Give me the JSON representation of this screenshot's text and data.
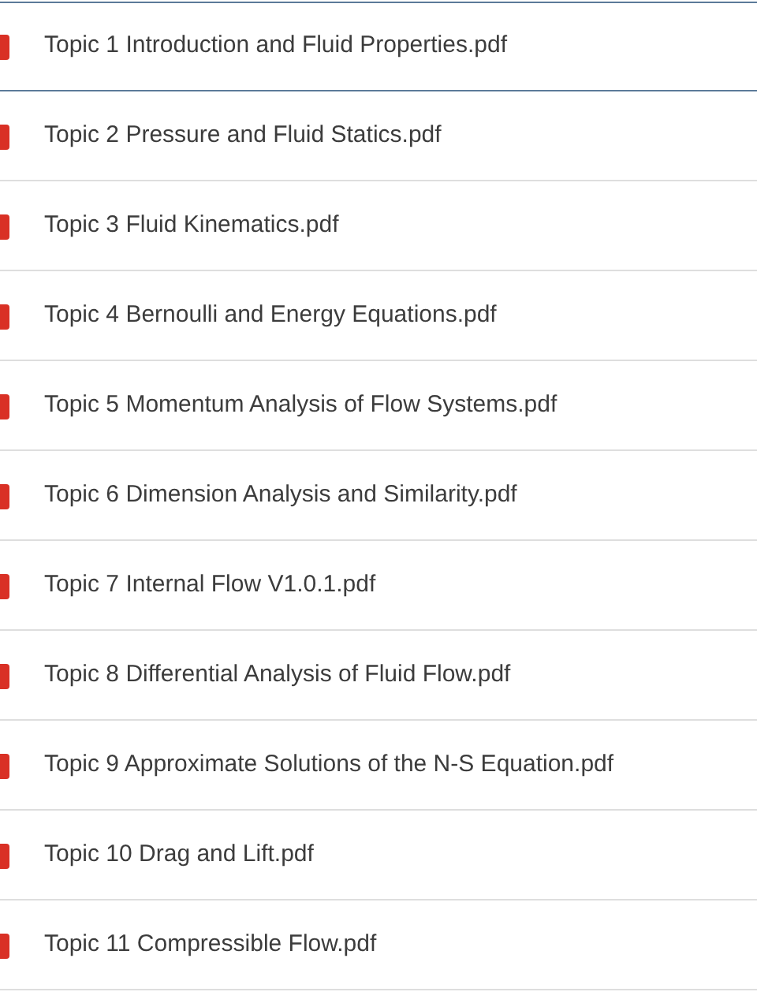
{
  "files": [
    {
      "name": "Topic 1 Introduction and Fluid Properties.pdf",
      "selected": true
    },
    {
      "name": "Topic 2 Pressure and Fluid Statics.pdf",
      "selected": false
    },
    {
      "name": "Topic 3 Fluid Kinematics.pdf",
      "selected": false
    },
    {
      "name": "Topic 4 Bernoulli and Energy Equations.pdf",
      "selected": false
    },
    {
      "name": "Topic 5 Momentum Analysis of Flow Systems.pdf",
      "selected": false
    },
    {
      "name": "Topic 6 Dimension Analysis and Similarity.pdf",
      "selected": false
    },
    {
      "name": "Topic 7 Internal Flow V1.0.1.pdf",
      "selected": false
    },
    {
      "name": "Topic 8 Differential Analysis of Fluid Flow.pdf",
      "selected": false
    },
    {
      "name": "Topic 9 Approximate Solutions of the N-S Equation.pdf",
      "selected": false
    },
    {
      "name": "Topic 10 Drag and Lift.pdf",
      "selected": false
    },
    {
      "name": "Topic 11 Compressible Flow.pdf",
      "selected": false
    }
  ]
}
